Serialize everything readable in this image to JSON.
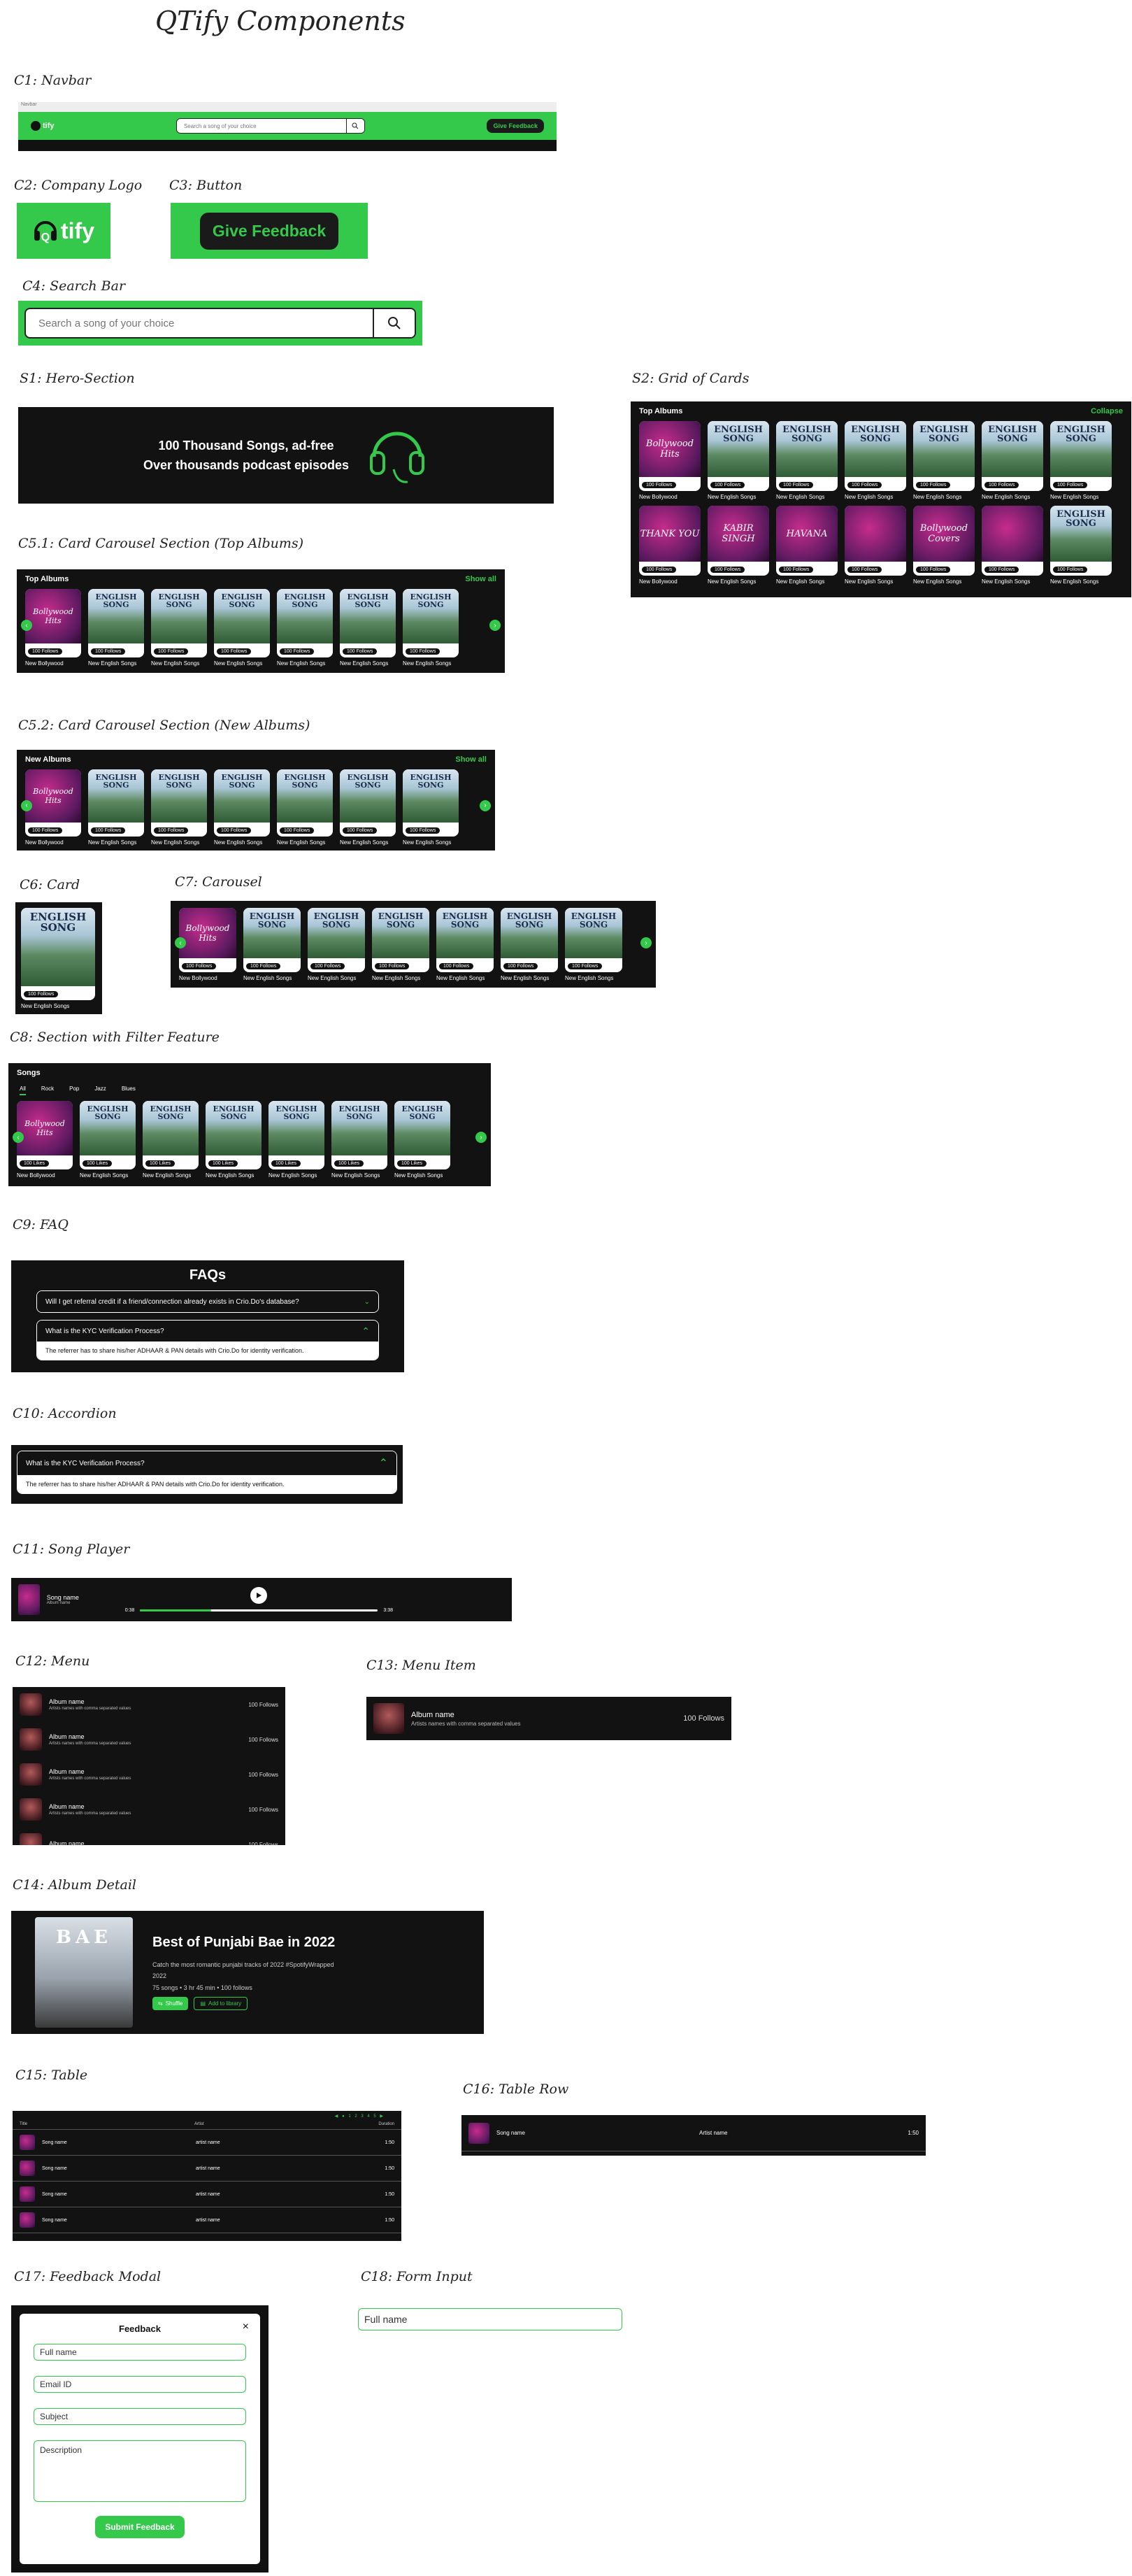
{
  "page_title": "QTify Components",
  "labels": {
    "c1": "C1: Navbar",
    "c2": "C2: Company Logo",
    "c3": "C3: Button",
    "c4": "C4: Search Bar",
    "s1": "S1: Hero-Section",
    "s2": "S2: Grid of Cards",
    "c51": "C5.1: Card Carousel Section (Top Albums)",
    "c52": "C5.2: Card Carousel Section (New Albums)",
    "c6": "C6: Card",
    "c7": "C7: Carousel",
    "c8": "C8: Section with Filter Feature",
    "c9": "C9: FAQ",
    "c10": "C10: Accordion",
    "c11": "C11: Song Player",
    "c12": "C12: Menu",
    "c13": "C13: Menu Item",
    "c14": "C14: Album Detail",
    "c15": "C15: Table",
    "c16": "C16: Table Row",
    "c17": "C17: Feedback Modal",
    "c18": "C18: Form Input"
  },
  "navbar": {
    "frame_label": "Navbar",
    "logo_text": "tify",
    "search_placeholder": "Search a song of your choice",
    "feedback_label": "Give Feedback"
  },
  "logo": {
    "q": "Q",
    "text": "tify"
  },
  "button": {
    "label": "Give Feedback"
  },
  "search": {
    "placeholder": "Search a song of your choice"
  },
  "hero": {
    "line1": "100 Thousand Songs, ad-free",
    "line2": "Over thousands podcast episodes"
  },
  "grid": {
    "title": "Top Albums",
    "action": "Collapse",
    "row1": [
      {
        "caption": "New Bollywood",
        "chip": "100 Follows",
        "art": "Bollywood Hits"
      },
      {
        "caption": "New English Songs",
        "chip": "100 Follows",
        "art": "ENGLISH SONG"
      },
      {
        "caption": "New English Songs",
        "chip": "100 Follows",
        "art": "ENGLISH SONG"
      },
      {
        "caption": "New English Songs",
        "chip": "100 Follows",
        "art": "ENGLISH SONG"
      },
      {
        "caption": "New English Songs",
        "chip": "100 Follows",
        "art": "ENGLISH SONG"
      },
      {
        "caption": "New English Songs",
        "chip": "100 Follows",
        "art": "ENGLISH SONG"
      },
      {
        "caption": "New English Songs",
        "chip": "100 Follows",
        "art": "ENGLISH SONG"
      }
    ],
    "row2": [
      {
        "caption": "New Bollywood",
        "chip": "100 Follows",
        "art": "THANK YOU"
      },
      {
        "caption": "New English Songs",
        "chip": "100 Follows",
        "art": "KABIR SINGH"
      },
      {
        "caption": "New English Songs",
        "chip": "100 Follows",
        "art": "HAVANA"
      },
      {
        "caption": "New English Songs",
        "chip": "100 Follows",
        "art": ""
      },
      {
        "caption": "New English Songs",
        "chip": "100 Follows",
        "art": "Bollywood Covers"
      },
      {
        "caption": "New English Songs",
        "chip": "100 Follows",
        "art": ""
      },
      {
        "caption": "New English Songs",
        "chip": "100 Follows",
        "art": "ENGLISH SONG"
      }
    ]
  },
  "top_albums": {
    "title": "Top Albums",
    "action": "Show all",
    "cards": [
      {
        "caption": "New Bollywood",
        "chip": "100 Follows",
        "art": "Bollywood Hits"
      },
      {
        "caption": "New English Songs",
        "chip": "100 Follows",
        "art": "ENGLISH SONG"
      },
      {
        "caption": "New English Songs",
        "chip": "100 Follows",
        "art": "ENGLISH SONG"
      },
      {
        "caption": "New English Songs",
        "chip": "100 Follows",
        "art": "ENGLISH SONG"
      },
      {
        "caption": "New English Songs",
        "chip": "100 Follows",
        "art": "ENGLISH SONG"
      },
      {
        "caption": "New English Songs",
        "chip": "100 Follows",
        "art": "ENGLISH SONG"
      },
      {
        "caption": "New English Songs",
        "chip": "100 Follows",
        "art": "ENGLISH SONG"
      }
    ]
  },
  "new_albums": {
    "title": "New Albums",
    "action": "Show all",
    "cards": [
      {
        "caption": "New Bollywood",
        "chip": "100 Follows",
        "art": "Bollywood Hits"
      },
      {
        "caption": "New English Songs",
        "chip": "100 Follows",
        "art": "ENGLISH SONG"
      },
      {
        "caption": "New English Songs",
        "chip": "100 Follows",
        "art": "ENGLISH SONG"
      },
      {
        "caption": "New English Songs",
        "chip": "100 Follows",
        "art": "ENGLISH SONG"
      },
      {
        "caption": "New English Songs",
        "chip": "100 Follows",
        "art": "ENGLISH SONG"
      },
      {
        "caption": "New English Songs",
        "chip": "100 Follows",
        "art": "ENGLISH SONG"
      },
      {
        "caption": "New English Songs",
        "chip": "100 Follows",
        "art": "ENGLISH SONG"
      }
    ]
  },
  "single_card": {
    "caption": "New English Songs",
    "chip": "100 Follows",
    "art": "ENGLISH SONG"
  },
  "carousel": {
    "cards": [
      {
        "caption": "New Bollywood",
        "chip": "100 Follows",
        "art": "Bollywood Hits"
      },
      {
        "caption": "New English Songs",
        "chip": "100 Follows",
        "art": "ENGLISH SONG"
      },
      {
        "caption": "New English Songs",
        "chip": "100 Follows",
        "art": "ENGLISH SONG"
      },
      {
        "caption": "New English Songs",
        "chip": "100 Follows",
        "art": "ENGLISH SONG"
      },
      {
        "caption": "New English Songs",
        "chip": "100 Follows",
        "art": "ENGLISH SONG"
      },
      {
        "caption": "New English Songs",
        "chip": "100 Follows",
        "art": "ENGLISH SONG"
      },
      {
        "caption": "New English Songs",
        "chip": "100 Follows",
        "art": "ENGLISH SONG"
      }
    ]
  },
  "songs": {
    "title": "Songs",
    "filters": [
      "All",
      "Rock",
      "Pop",
      "Jazz",
      "Blues"
    ],
    "active_filter": "All",
    "cards": [
      {
        "caption": "New Bollywood",
        "chip": "100 Likes",
        "art": "Bollywood Hits"
      },
      {
        "caption": "New English Songs",
        "chip": "100 Likes",
        "art": "ENGLISH SONG"
      },
      {
        "caption": "New English Songs",
        "chip": "100 Likes",
        "art": "ENGLISH SONG"
      },
      {
        "caption": "New English Songs",
        "chip": "100 Likes",
        "art": "ENGLISH SONG"
      },
      {
        "caption": "New English Songs",
        "chip": "100 Likes",
        "art": "ENGLISH SONG"
      },
      {
        "caption": "New English Songs",
        "chip": "100 Likes",
        "art": "ENGLISH SONG"
      },
      {
        "caption": "New English Songs",
        "chip": "100 Likes",
        "art": "ENGLISH SONG"
      }
    ]
  },
  "faq": {
    "title": "FAQs",
    "items": [
      {
        "q": "Will I get referral credit if a friend/connection already exists in Crio.Do's database?",
        "a": "",
        "open": false
      },
      {
        "q": "What is the KYC Verification Process?",
        "a": "The referrer has to share his/her ADHAAR & PAN details with Crio.Do for identity verification.",
        "open": true
      }
    ]
  },
  "accordion": {
    "q": "What is the KYC Verification Process?",
    "a": "The referrer has to share his/her ADHAAR & PAN details with Crio.Do for identity verification."
  },
  "player": {
    "song": "Song name",
    "album": "Album name",
    "elapsed": "0:38",
    "total": "3:38",
    "progress": 0.3
  },
  "menu": {
    "items": [
      {
        "title": "Album name",
        "sub": "Artists names with comma separated values",
        "follows": "100 Follows"
      },
      {
        "title": "Album name",
        "sub": "Artists names with comma separated values",
        "follows": "100 Follows"
      },
      {
        "title": "Album name",
        "sub": "Artists names with comma separated values",
        "follows": "100 Follows"
      },
      {
        "title": "Album name",
        "sub": "Artists names with comma separated values",
        "follows": "100 Follows"
      },
      {
        "title": "Album name",
        "sub": "",
        "follows": "100 Follows"
      }
    ]
  },
  "menu_item": {
    "title": "Album name",
    "sub": "Artists names with comma separated values",
    "follows": "100 Follows"
  },
  "album": {
    "art": "BAE",
    "title": "Best of Punjabi Bae in 2022",
    "desc": "Catch the most romantic punjabi tracks of 2022 #SpotifyWrapped",
    "year": "2022",
    "stats": "75 songs • 3 hr 45 min • 100 follows",
    "shuffle": "Shuffle",
    "library": "Add to library"
  },
  "table": {
    "pager": "◀ ● 1 2 3 4 5 ▶",
    "headers": [
      "Title",
      "Artist",
      "Duration"
    ],
    "rows": [
      {
        "title": "Song name",
        "artist": "artist name",
        "dur": "1:50"
      },
      {
        "title": "Song name",
        "artist": "artist name",
        "dur": "1:50"
      },
      {
        "title": "Song name",
        "artist": "artist name",
        "dur": "1:50"
      },
      {
        "title": "Song name",
        "artist": "artist name",
        "dur": "1:50"
      }
    ]
  },
  "table_row": {
    "title": "Song name",
    "artist": "Artist name",
    "dur": "1:50"
  },
  "modal": {
    "title": "Feedback",
    "close": "×",
    "fields": [
      "Full name",
      "Email ID",
      "Subject",
      "Description"
    ],
    "submit": "Submit Feedback"
  },
  "form_input": {
    "placeholder": "Full name"
  },
  "colors": {
    "accent": "#34c94b",
    "dark": "#121212"
  }
}
